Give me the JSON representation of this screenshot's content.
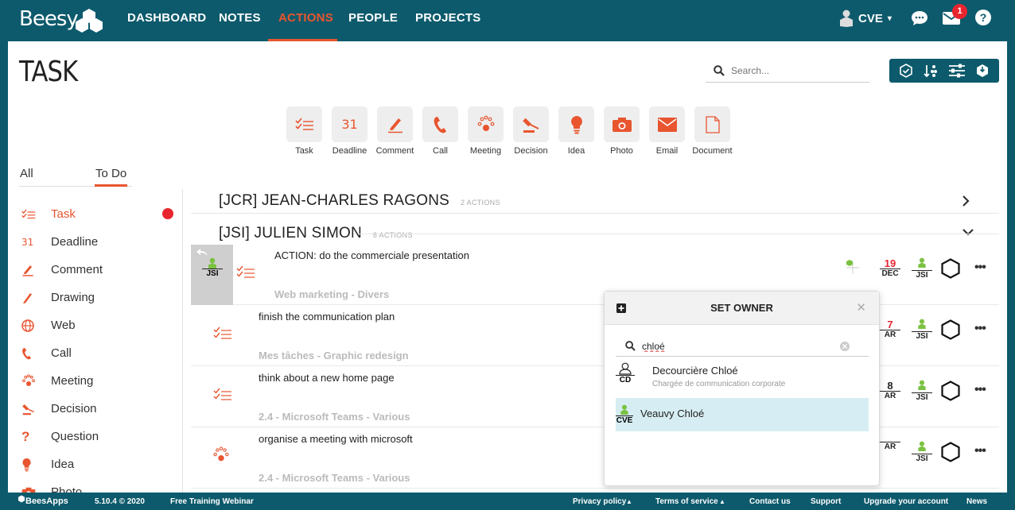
{
  "app": {
    "logo": "Beesy"
  },
  "nav": {
    "items": [
      "DASHBOARD",
      "NOTES",
      "ACTIONS",
      "PEOPLE",
      "PROJECTS"
    ],
    "active": "ACTIONS"
  },
  "user": {
    "initials": "CVE",
    "notifications": "1"
  },
  "page": {
    "title": "TASK"
  },
  "search": {
    "placeholder": "Search..."
  },
  "types": [
    {
      "label": "Task",
      "icon": "task-icon"
    },
    {
      "label": "Deadline",
      "icon": "deadline-icon"
    },
    {
      "label": "Comment",
      "icon": "comment-icon"
    },
    {
      "label": "Call",
      "icon": "call-icon"
    },
    {
      "label": "Meeting",
      "icon": "meeting-icon"
    },
    {
      "label": "Decision",
      "icon": "decision-icon"
    },
    {
      "label": "Idea",
      "icon": "idea-icon"
    },
    {
      "label": "Photo",
      "icon": "photo-icon"
    },
    {
      "label": "Email",
      "icon": "email-icon"
    },
    {
      "label": "Document",
      "icon": "document-icon"
    }
  ],
  "filters": {
    "all": "All",
    "todo": "To Do"
  },
  "sidebar": {
    "items": [
      {
        "label": "Task",
        "icon": "task-icon"
      },
      {
        "label": "Deadline",
        "icon": "deadline-icon"
      },
      {
        "label": "Comment",
        "icon": "comment-icon"
      },
      {
        "label": "Drawing",
        "icon": "drawing-icon"
      },
      {
        "label": "Web",
        "icon": "web-icon"
      },
      {
        "label": "Call",
        "icon": "call-icon"
      },
      {
        "label": "Meeting",
        "icon": "meeting-icon"
      },
      {
        "label": "Decision",
        "icon": "decision-icon"
      },
      {
        "label": "Question",
        "icon": "question-icon"
      },
      {
        "label": "Idea",
        "icon": "idea-icon"
      },
      {
        "label": "Photo",
        "icon": "photo-icon"
      }
    ]
  },
  "groups": [
    {
      "name": "[JCR] JEAN-CHARLES RAGONS",
      "count": "2 ACTIONS"
    },
    {
      "name": "[JSI] JULIEN SIMON",
      "count": "8 ACTIONS"
    }
  ],
  "deadline_icon_text": "31",
  "rows": [
    {
      "title": "ACTION: do the commerciale presentation",
      "project": "Web marketing - Divers",
      "day": "19",
      "month": "DEC",
      "owner": "JSI",
      "undo_owner": "JSI"
    },
    {
      "title": "finish the communication plan",
      "project": "Mes tâches - Graphic redesign",
      "day": "7",
      "month": "AR",
      "owner": "JSI"
    },
    {
      "title": "think about a new home page",
      "project": "2.4 - Microsoft Teams - Various",
      "day": "8",
      "month": "AR",
      "owner": "JSI"
    },
    {
      "title": "organise a meeting with microsoft",
      "project": "2.4 - Microsoft Teams - Various",
      "day": "",
      "month": "AR",
      "owner": "JSI"
    }
  ],
  "popup": {
    "title": "SET OWNER",
    "search_value": "chloé",
    "candidates": [
      {
        "name": "Decourcière Chloé",
        "subtitle": "Chargée de communication corporate",
        "initials": "CD"
      },
      {
        "name": "Veauvy Chloé",
        "subtitle": "",
        "initials": "CVE"
      }
    ]
  },
  "footer": {
    "brand": "BeesApps",
    "version": "5.10.4 © 2020",
    "webinar": "Free Training Webinar",
    "privacy": "Privacy policy",
    "terms": "Terms of service",
    "contact": "Contact us",
    "support": "Support",
    "upgrade": "Upgrade your account",
    "news": "News"
  },
  "colors": {
    "brand": "#0d5a6c",
    "accent": "#e8552f",
    "alert": "#e8252f",
    "owner_green": "#7cc242",
    "selected_row": "#d6eef3"
  }
}
